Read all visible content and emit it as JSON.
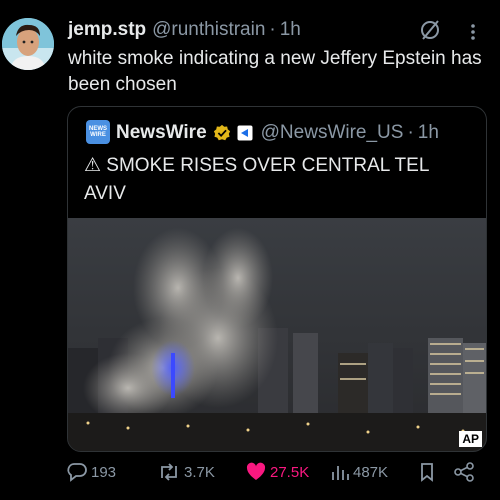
{
  "tweet": {
    "display_name": "jemp.stp",
    "handle": "@runthistrain",
    "separator": "·",
    "time": "1h",
    "text": "white smoke indicating a new Jeffery Epstein has been chosen"
  },
  "quote": {
    "logo_line1": "NEWS",
    "logo_line2": "WIRE",
    "display_name": "NewsWire",
    "handle": "@NewsWire_US",
    "separator": "·",
    "time": "1h",
    "text": "⚠ SMOKE RISES OVER CENTRAL TEL AVIV",
    "photo_credit": "AP"
  },
  "actions": {
    "replies": "193",
    "reposts": "3.7K",
    "likes": "27.5K",
    "views": "487K"
  },
  "colors": {
    "like_pink": "#f91880",
    "muted": "#8b98a5",
    "verified_gold": "#e2b719",
    "affiliate_blue": "#1d6fe8"
  },
  "icons": [
    "avatar",
    "grok-icon",
    "more-icon",
    "newswire-logo",
    "verified-gold-icon",
    "affiliate-badge-icon",
    "reply-icon",
    "repost-icon",
    "like-icon",
    "views-icon",
    "bookmark-icon",
    "share-icon"
  ]
}
